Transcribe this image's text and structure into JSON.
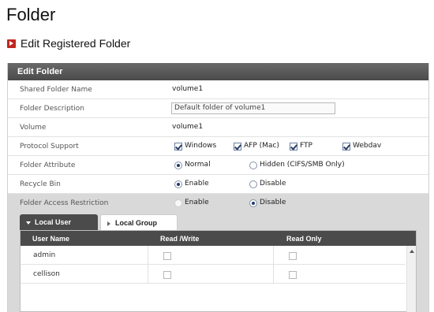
{
  "page": {
    "title": "Folder"
  },
  "section": {
    "title": "Edit Registered Folder"
  },
  "panel": {
    "header": "Edit Folder"
  },
  "form": {
    "shared_folder_name": {
      "label": "Shared Folder Name",
      "value": "volume1"
    },
    "folder_description": {
      "label": "Folder Description",
      "value": "Default folder of volume1"
    },
    "volume": {
      "label": "Volume",
      "value": "volume1"
    },
    "protocol_support": {
      "label": "Protocol Support",
      "options": [
        {
          "label": "Windows",
          "checked": true
        },
        {
          "label": "AFP (Mac)",
          "checked": true
        },
        {
          "label": "FTP",
          "checked": true
        },
        {
          "label": "Webdav",
          "checked": true
        }
      ]
    },
    "folder_attribute": {
      "label": "Folder Attribute",
      "options": [
        {
          "label": "Normal",
          "selected": true
        },
        {
          "label": "Hidden (CIFS/SMB Only)",
          "selected": false
        }
      ]
    },
    "recycle_bin": {
      "label": "Recycle Bin",
      "options": [
        {
          "label": "Enable",
          "selected": true
        },
        {
          "label": "Disable",
          "selected": false
        }
      ]
    },
    "folder_access_restriction": {
      "label": "Folder Access Restriction",
      "options": [
        {
          "label": "Enable",
          "selected": false
        },
        {
          "label": "Disable",
          "selected": true
        }
      ]
    }
  },
  "tabs": [
    {
      "label": "Local User",
      "active": true
    },
    {
      "label": "Local Group",
      "active": false
    }
  ],
  "table": {
    "columns": [
      "User Name",
      "Read /Write",
      "Read Only"
    ],
    "rows": [
      {
        "name": "admin",
        "read_write": false,
        "read_only": false
      },
      {
        "name": "cellison",
        "read_write": false,
        "read_only": false
      }
    ]
  }
}
